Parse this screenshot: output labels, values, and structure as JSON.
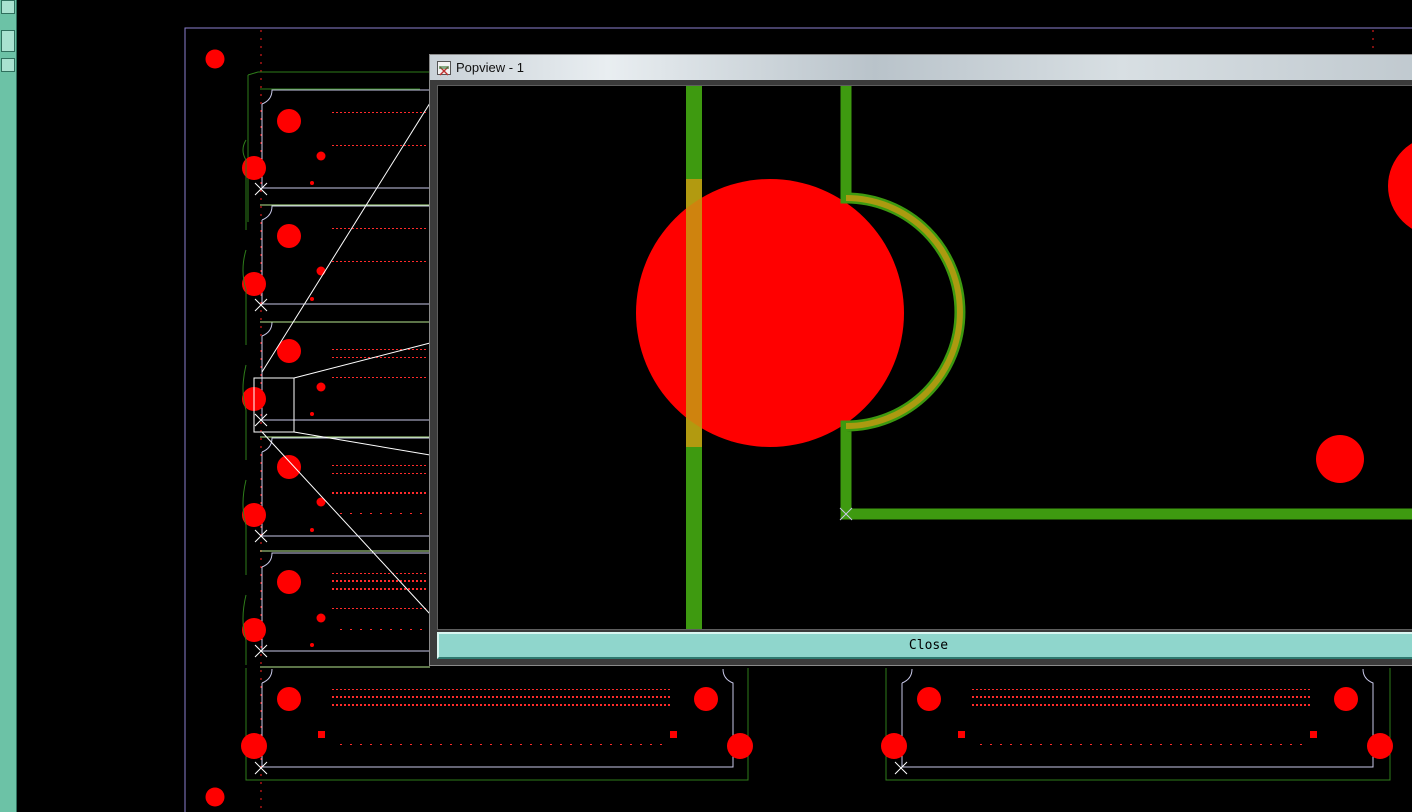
{
  "popview": {
    "title": "Popview - 1",
    "close_label": "Close"
  },
  "colors": {
    "background": "#000000",
    "pad": "#ff0000",
    "outline_green": "#2e7d1a",
    "trace_green": "#3e9a10",
    "silk": "#c8c8e8",
    "close_button": "#8fd6cc"
  },
  "icons": {
    "popview_app_icon": "window-app-icon",
    "origin_marker": "x-cross-icon"
  }
}
